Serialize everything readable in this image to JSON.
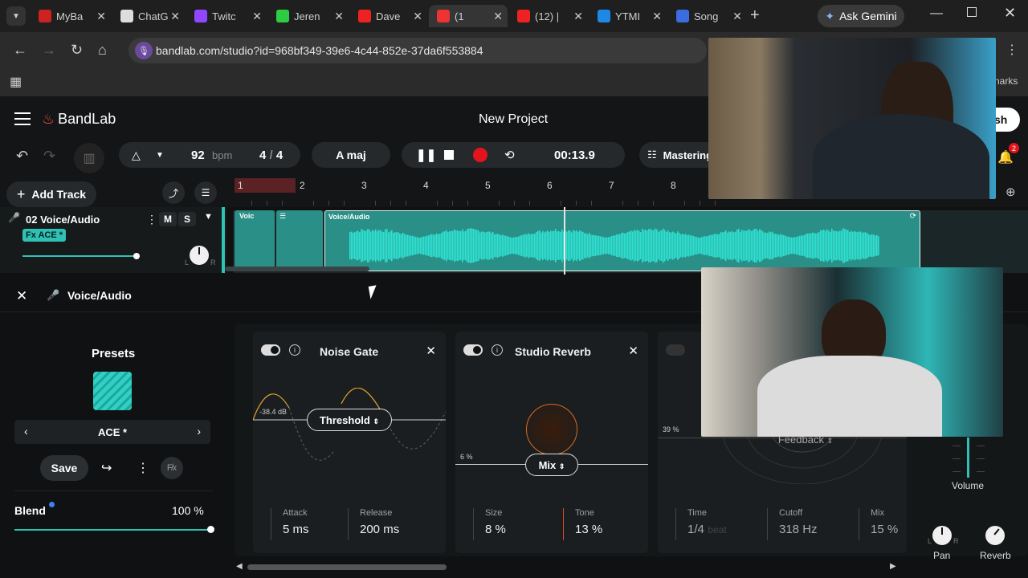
{
  "tabs": [
    {
      "label": "MyBa",
      "color": "#c22"
    },
    {
      "label": "ChatG",
      "color": "#ddd"
    },
    {
      "label": "Twitc",
      "color": "#9146ff"
    },
    {
      "label": "Jeren",
      "color": "#2ecc40"
    },
    {
      "label": "Dave",
      "color": "#e22"
    },
    {
      "label": "(1",
      "color": "#e33"
    },
    {
      "label": "(12) |",
      "color": "#e22"
    },
    {
      "label": "YTMI",
      "color": "#1e88e5"
    },
    {
      "label": "Song",
      "color": "#3b6ce0"
    }
  ],
  "browser": {
    "url": "bandlab.com/studio?id=968bf349-39e6-4c44-852e-37da6f553884",
    "ask_gemini": "Ask Gemini",
    "bookmarks_label": "narks"
  },
  "app": {
    "brand": "BandLab",
    "project_title": "New Project",
    "publish_partial": "sh",
    "bpm_value": "92",
    "bpm_unit": "bpm",
    "time_sig_num": "4",
    "time_sig_den": "4",
    "key": "A maj",
    "time": "00:13.9",
    "mastering": "Mastering",
    "notif_count": "2",
    "add_track": "Add Track"
  },
  "ruler": [
    "1",
    "2",
    "3",
    "4",
    "5",
    "6",
    "7",
    "8"
  ],
  "track": {
    "name": "02 Voice/Audio",
    "mute": "M",
    "solo": "S",
    "fx_badge": "Fx ACE *",
    "clip_label_small": "Voic",
    "clip_label": "Voice/Audio"
  },
  "editor": {
    "title": "Voice/Audio",
    "presets_heading": "Presets",
    "preset_name": "ACE *",
    "save": "Save",
    "blend_label": "Blend",
    "blend_value": "100 %",
    "blend_fraction": 1.0
  },
  "effects": {
    "noise_gate": {
      "title": "Noise Gate",
      "threshold_readout": "-38.4 dB",
      "selector": "Threshold",
      "attack_label": "Attack",
      "attack_value": "5 ms",
      "release_label": "Release",
      "release_value": "200 ms"
    },
    "studio_reverb": {
      "title": "Studio Reverb",
      "mix_readout": "6 %",
      "selector": "Mix",
      "size_label": "Size",
      "size_value": "8 %",
      "tone_label": "Tone",
      "tone_value": "13 %"
    },
    "delay": {
      "readout": "39 %",
      "selector": "Feedback",
      "time_label": "Time",
      "time_value": "1/4",
      "time_unit": "beat",
      "cutoff_label": "Cutoff",
      "cutoff_value": "318 Hz",
      "mix_label": "Mix",
      "mix_value": "15 %"
    }
  },
  "mixer": {
    "volume_label": "Volume",
    "pan_label": "Pan",
    "reverb_label": "Reverb"
  }
}
